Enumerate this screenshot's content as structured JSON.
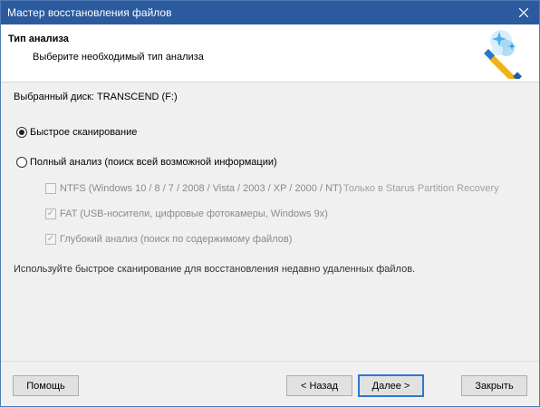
{
  "window": {
    "title": "Мастер восстановления файлов",
    "accent_color": "#2b5b9e",
    "close_icon": "close-icon"
  },
  "header": {
    "title": "Тип анализа",
    "subtitle": "Выберите необходимый тип анализа",
    "icon": "magic-wand-icon"
  },
  "main": {
    "selected_disk_label": "Выбранный диск: TRANSCEND (F:)",
    "options": {
      "quick_scan": {
        "label": "Быстрое сканирование",
        "checked": true
      },
      "full_analysis": {
        "label": "Полный анализ (поиск всей возможной информации)",
        "checked": false
      }
    },
    "sub_options": {
      "ntfs": {
        "label": "NTFS (Windows 10 / 8 / 7 / 2008 / Vista / 2003 / XP / 2000 / NT)",
        "note": "Только в Starus Partition Recovery",
        "checked": false
      },
      "fat": {
        "label": "FAT (USB-носители, цифровые фотокамеры, Windows 9x)",
        "checked": true
      },
      "deep": {
        "label": "Глубокий анализ (поиск по содержимому файлов)",
        "checked": true
      }
    },
    "hint": "Используйте быстрое сканирование для восстановления недавно удаленных файлов."
  },
  "footer": {
    "help_label": "Помощь",
    "back_label": "< Назад",
    "next_label": "Далее >",
    "close_label": "Закрыть"
  }
}
